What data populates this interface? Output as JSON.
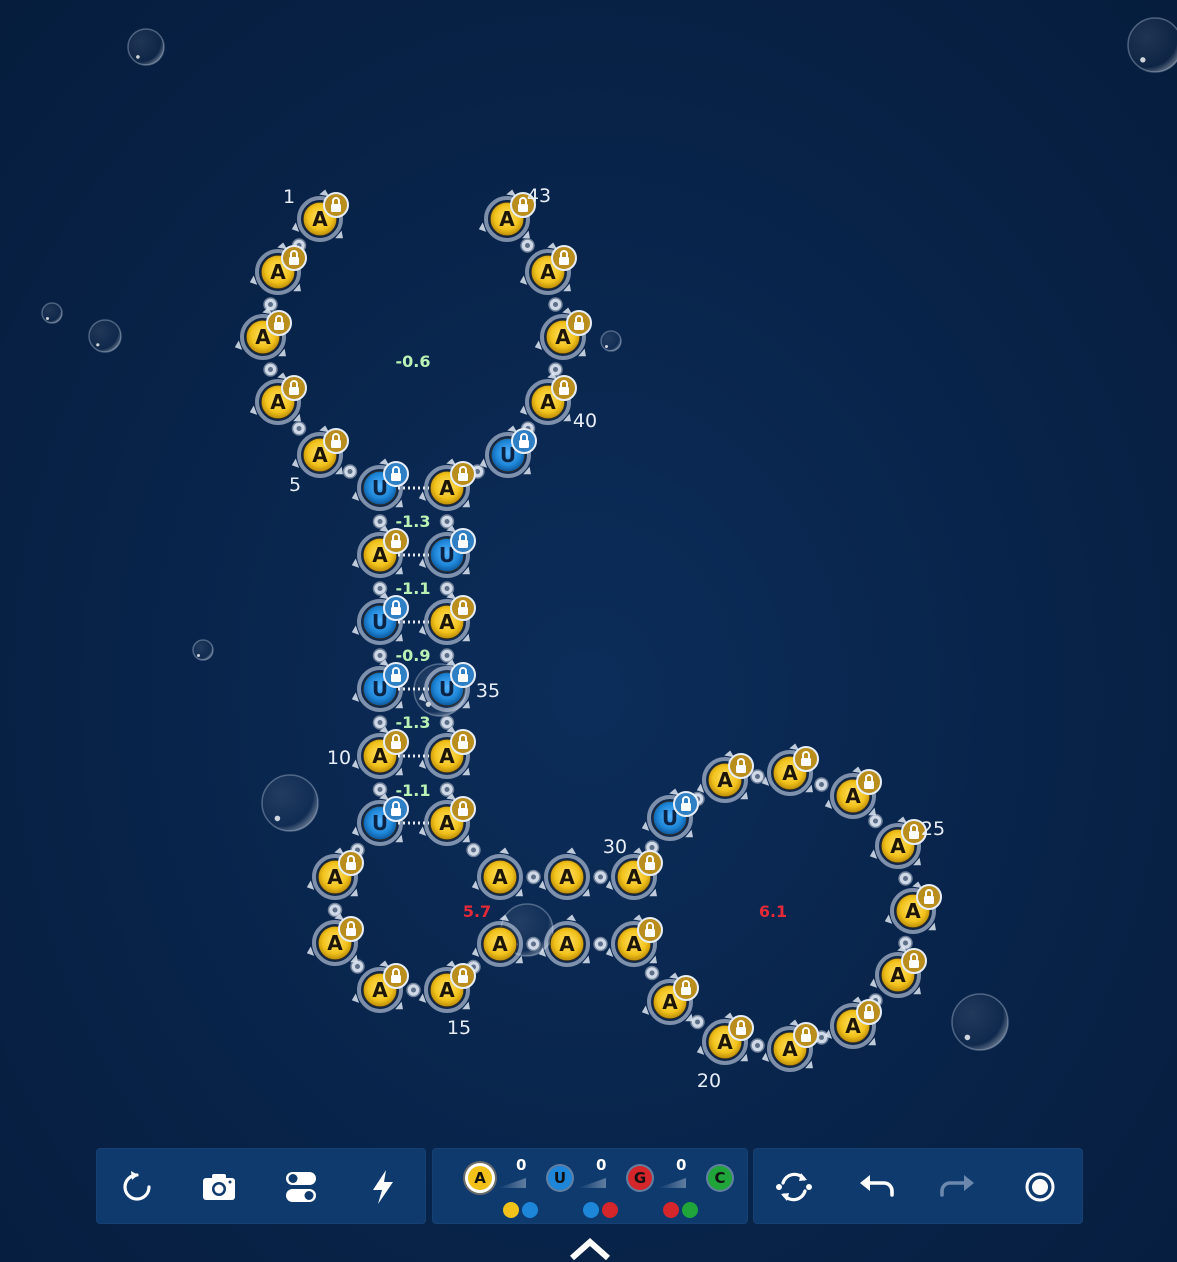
{
  "puzzle": {
    "sequence": "AAAAAUAUUAUAAAAAAAAAAAAAAAAAUAAAAAUAUAUAAAAAA",
    "structure": "(((((((((((((((((((((((((((((((((((((((((((((",
    "locked_all": true,
    "index_labels": [
      "1",
      "5",
      "10",
      "15",
      "20",
      "25",
      "30",
      "35",
      "40",
      "43"
    ],
    "energies": [
      {
        "value": "-0.6",
        "status": "stable"
      },
      {
        "value": "-1.3",
        "status": "stable"
      },
      {
        "value": "-1.1",
        "status": "stable"
      },
      {
        "value": "-0.9",
        "status": "stable"
      },
      {
        "value": "-1.3",
        "status": "stable"
      },
      {
        "value": "-1.1",
        "status": "stable"
      },
      {
        "value": "5.7",
        "status": "unstable"
      },
      {
        "value": "6.1",
        "status": "unstable"
      }
    ]
  },
  "colors": {
    "A": "#f2c21b",
    "U": "#1e86d8",
    "G": "#d4262b",
    "C": "#1fa53a",
    "stable_energy": "#b9f2b4",
    "unstable_energy": "#e42a38",
    "toolbar": "#0e3a6e",
    "background": "#082349"
  },
  "toolbar_left": {
    "buttons": [
      {
        "name": "reset-button",
        "icon": "reset-icon"
      },
      {
        "name": "screenshot-button",
        "icon": "camera-icon"
      },
      {
        "name": "settings-button",
        "icon": "toggle-icon"
      },
      {
        "name": "boost-button",
        "icon": "lightning-icon"
      }
    ]
  },
  "toolbar_mid": {
    "pairs": [
      {
        "base": "A",
        "count": "0",
        "dots": [
          "#f2c21b",
          "#1e86d8"
        ]
      },
      {
        "base": "U",
        "count": "0",
        "dots": [
          "#1e86d8",
          "#d4262b"
        ]
      },
      {
        "base": "G",
        "count": "0",
        "dots": [
          "#d4262b",
          "#1fa53a"
        ]
      },
      {
        "base": "C",
        "count": "",
        "dots": []
      }
    ]
  },
  "toolbar_right": {
    "buttons": [
      {
        "name": "swap-button",
        "icon": "swap-icon"
      },
      {
        "name": "undo-button",
        "icon": "undo-icon"
      },
      {
        "name": "redo-button",
        "icon": "redo-icon"
      },
      {
        "name": "target-button",
        "icon": "target-icon"
      }
    ]
  }
}
